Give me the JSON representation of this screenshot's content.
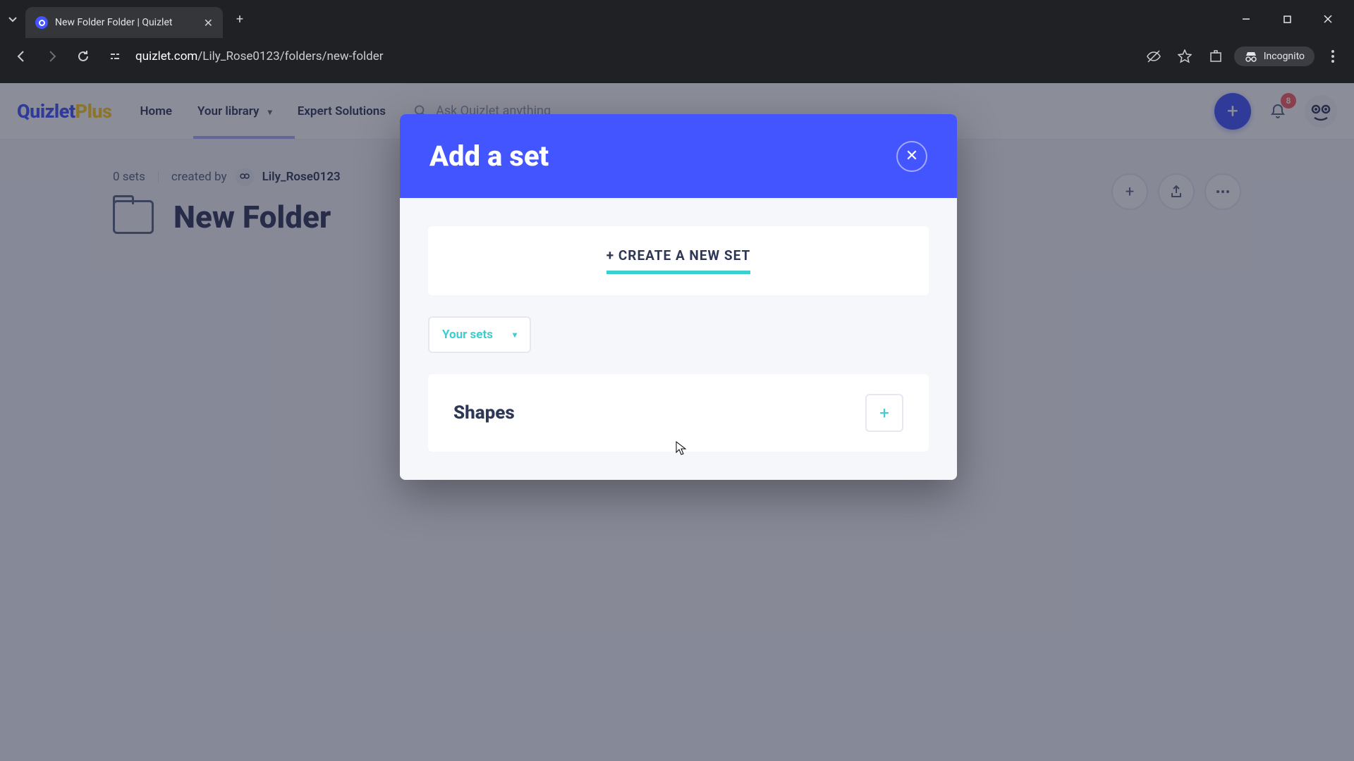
{
  "browser": {
    "tab_title": "New Folder Folder | Quizlet",
    "url_display": "quizlet.com/Lily_Rose0123/folders/new-folder",
    "url_domain": "quizlet.com",
    "url_path": "/Lily_Rose0123/folders/new-folder",
    "incognito_label": "Incognito"
  },
  "header": {
    "logo_main": "Quizlet",
    "logo_suffix": "Plus",
    "nav": {
      "home": "Home",
      "library": "Your library",
      "expert": "Expert Solutions"
    },
    "search_placeholder": "Ask Quizlet anything",
    "notification_count": "8"
  },
  "folder": {
    "set_count": "0 sets",
    "created_by_label": "created by",
    "creator": "Lily_Rose0123",
    "title": "New Folder"
  },
  "modal": {
    "title": "Add a set",
    "create_new_label": "+ CREATE A NEW SET",
    "filter_label": "Your sets",
    "sets": [
      {
        "name": "Shapes"
      }
    ]
  }
}
